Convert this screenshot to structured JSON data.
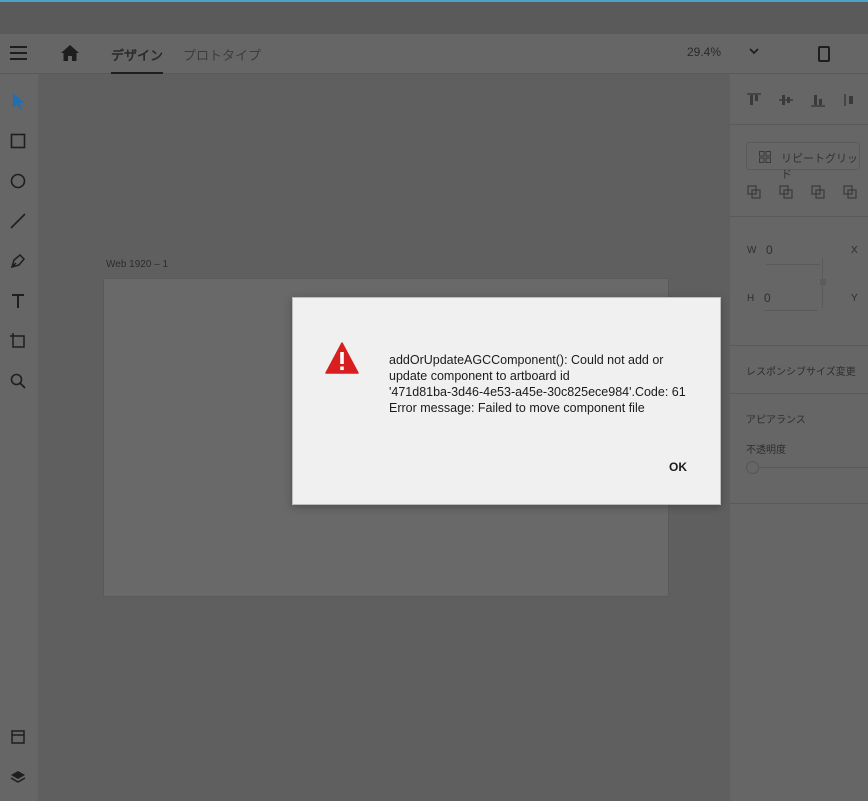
{
  "toolbar": {
    "tabs": [
      {
        "label": "デザイン",
        "active": true
      },
      {
        "label": "プロトタイプ",
        "active": false
      }
    ],
    "zoom": "29.4%"
  },
  "artboard": {
    "name": "Web 1920 – 1"
  },
  "right_panel": {
    "repeat_grid_label": "リピートグリッド",
    "w_label": "W",
    "w_value": "0",
    "h_label": "H",
    "h_value": "0",
    "x_label": "X",
    "y_label": "Y",
    "responsive_resize_label": "レスポンシブサイズ変更",
    "appearance_label": "アピアランス",
    "opacity_label": "不透明度"
  },
  "dialog": {
    "message_lines": [
      "addOrUpdateAGCComponent(): Could not add or",
      "update component to artboard id",
      "'471d81ba-3d46-4e53-a45e-30c825ece984'.Code: 61",
      "Error message: Failed to move component file"
    ],
    "ok_label": "OK",
    "icon": "warning-icon",
    "icon_color": "#d81e1e"
  }
}
